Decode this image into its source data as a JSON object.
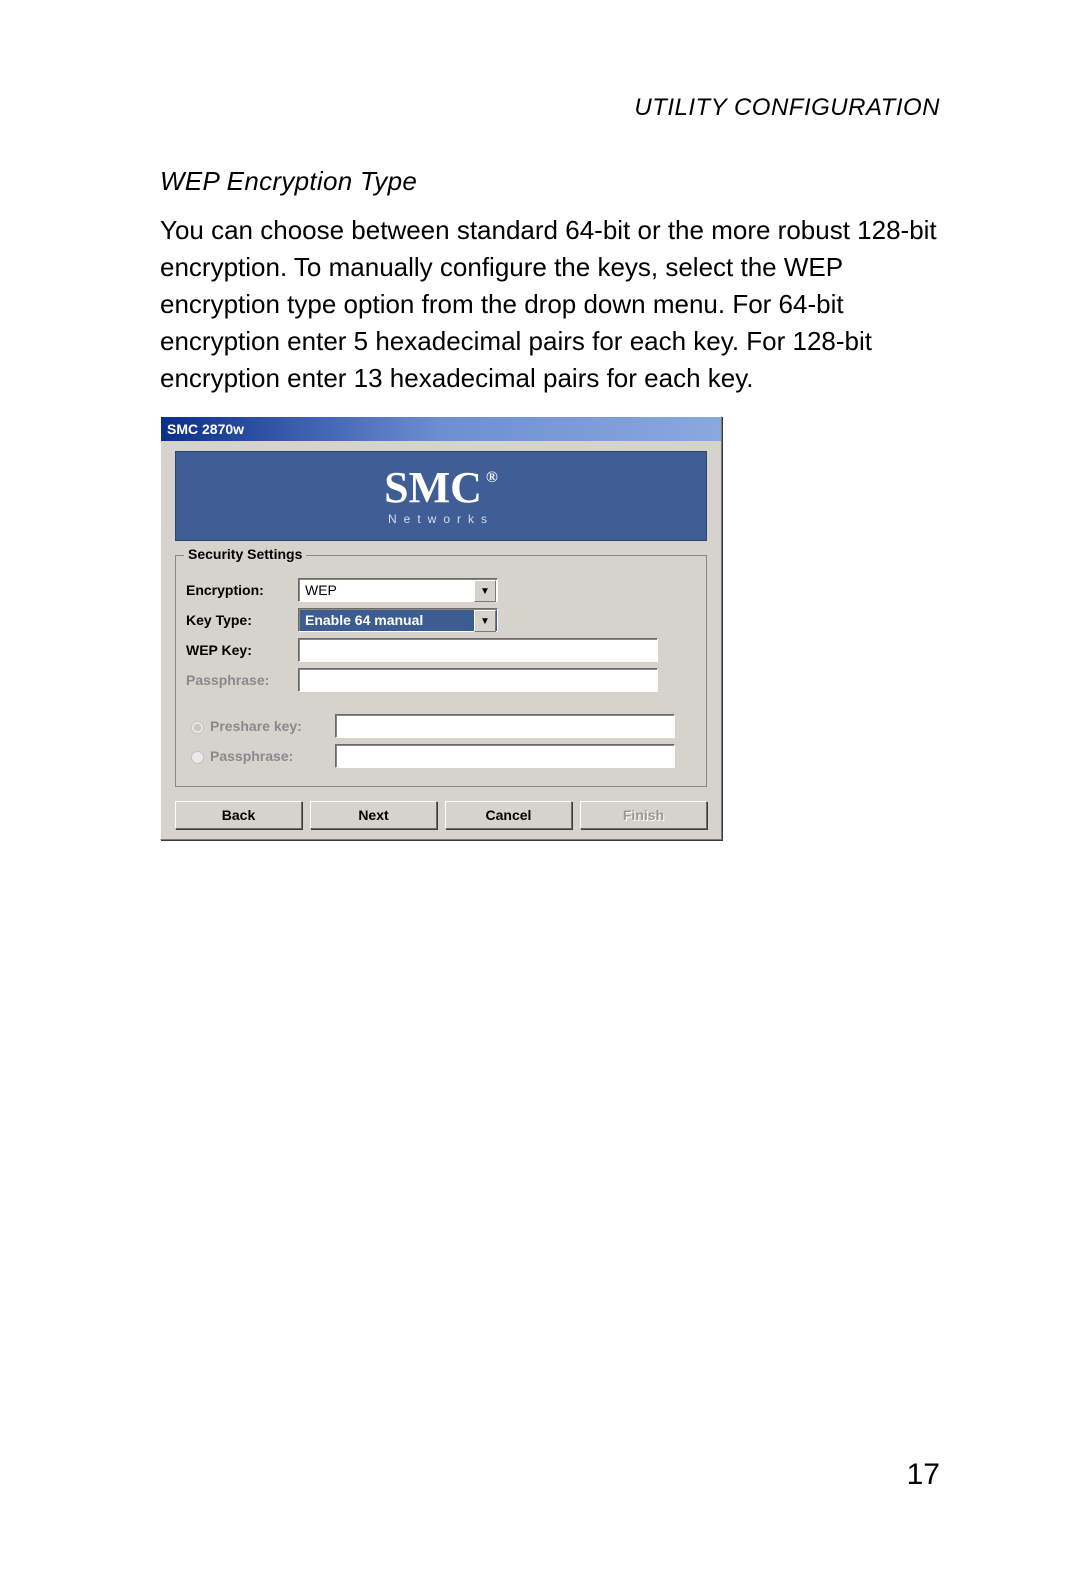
{
  "page": {
    "header": "UTILITY CONFIGURATION",
    "section_title": "WEP Encryption Type",
    "body": "You can choose between standard 64-bit or the more robust 128-bit encryption. To manually configure the keys, select the WEP encryption type option from the drop down menu. For 64-bit encryption enter 5 hexadecimal pairs for each key. For 128-bit encryption enter 13 hexadecimal pairs for each key.",
    "page_number": "17"
  },
  "dialog": {
    "title": "SMC 2870w",
    "brand": "SMC",
    "brand_reg": "®",
    "brand_sub": "Networks",
    "group_title": "Security Settings",
    "labels": {
      "encryption": "Encryption:",
      "key_type": "Key Type:",
      "wep_key": "WEP Key:",
      "passphrase": "Passphrase:",
      "preshare_key": "Preshare key:",
      "passphrase2": "Passphrase:"
    },
    "encryption": {
      "selected": "WEP"
    },
    "key_type": {
      "selected": "Enable 64 manual"
    },
    "wep_key_value": "",
    "passphrase_value": "",
    "preshare_value": "",
    "passphrase2_value": "",
    "buttons": {
      "back": "Back",
      "next": "Next",
      "cancel": "Cancel",
      "finish": "Finish"
    }
  }
}
